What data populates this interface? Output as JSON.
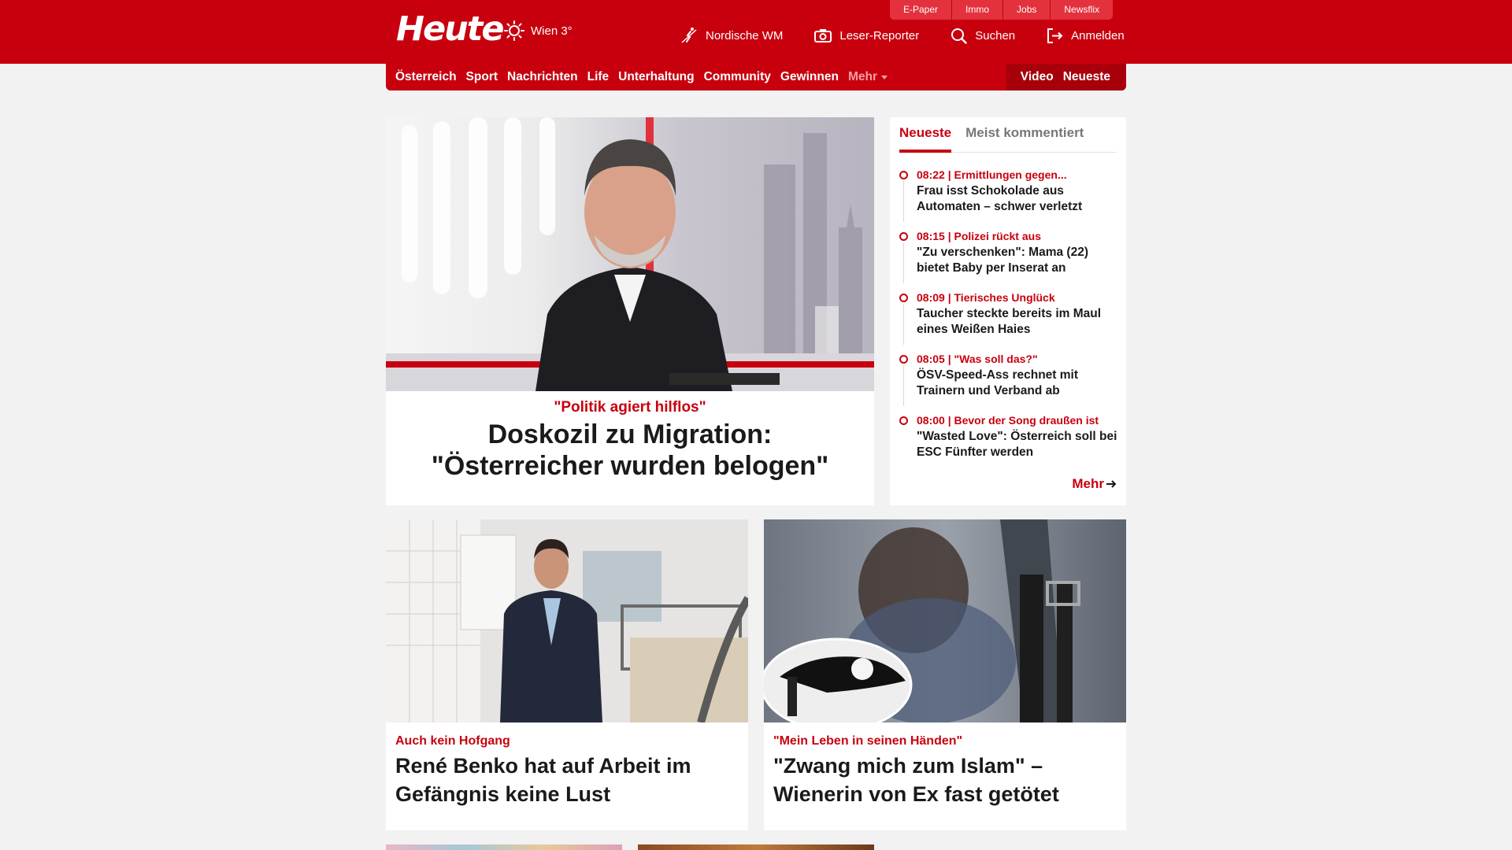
{
  "header": {
    "logo": "Heute",
    "weather": "Wien 3°",
    "top_links": [
      "E-Paper",
      "Immo",
      "Jobs",
      "Newsflix"
    ],
    "actions": {
      "nordic": "Nordische WM",
      "reporter": "Leser-Reporter",
      "search": "Suchen",
      "login": "Anmelden"
    }
  },
  "nav": {
    "items": [
      "Österreich",
      "Sport",
      "Nachrichten",
      "Life",
      "Unterhaltung",
      "Community",
      "Gewinnen"
    ],
    "more": "Mehr",
    "right": [
      "Video",
      "Neueste"
    ]
  },
  "hero": {
    "kicker": "\"Politik agiert hilflos\"",
    "title": "Doskozil zu Migration: \"Österreicher wurden belogen\""
  },
  "sidebar": {
    "tabs": [
      "Neueste",
      "Meist kommentiert"
    ],
    "items": [
      {
        "meta": "08:22 | Ermittlungen gegen...",
        "headline": "Frau isst Schokolade aus Automaten – schwer verletzt"
      },
      {
        "meta": "08:15 | Polizei rückt aus",
        "headline": "\"Zu verschenken\": Mama (22) bietet Baby per Inserat an"
      },
      {
        "meta": "08:09 | Tierisches Unglück",
        "headline": "Taucher steckte bereits im Maul eines Weißen Haies"
      },
      {
        "meta": "08:05 | \"Was soll das?\"",
        "headline": "ÖSV-Speed-Ass rechnet mit Trainern und Verband ab"
      },
      {
        "meta": "08:00 | Bevor der Song draußen ist",
        "headline": "\"Wasted Love\": Österreich soll bei ESC Fünfter werden"
      }
    ],
    "more": "Mehr"
  },
  "cards": [
    {
      "kicker": "Auch kein Hofgang",
      "title": "René Benko hat auf Arbeit im Gefängnis keine Lust"
    },
    {
      "kicker": "\"Mein Leben in seinen Händen\"",
      "title": "\"Zwang mich zum Islam\" – Wienerin von Ex fast getötet"
    }
  ],
  "colors": {
    "brand_red": "#c8000e",
    "background": "#f2f2f2"
  }
}
